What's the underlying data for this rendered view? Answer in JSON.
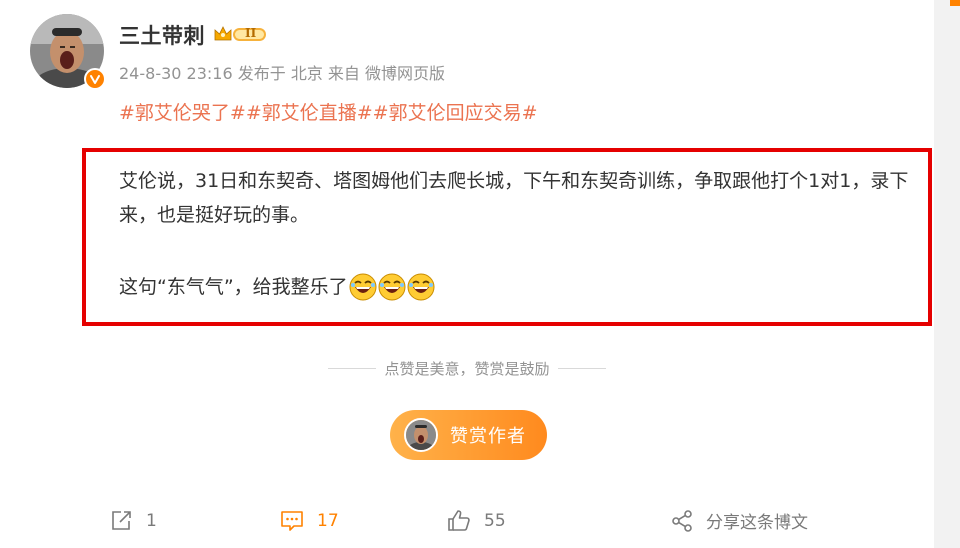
{
  "post": {
    "user_name": "三土带刺",
    "level_badge": "II",
    "meta": "24-8-30 23:16 发布于 北京 来自 微博网页版",
    "hashtags": "#郭艾伦哭了##郭艾伦直播##郭艾伦回应交易#",
    "paragraph_1": "艾伦说，31日和东契奇、塔图姆他们去爬长城，下午和东契奇训练，争取跟他打个1对1，录下来，也是挺好玩的事。",
    "paragraph_2": "这句“东气气”，给我整乐了",
    "emoji": [
      "laughing-emoji",
      "laughing-emoji",
      "laughing-emoji"
    ]
  },
  "reward": {
    "encourage_text": "点赞是美意，赞赏是鼓励",
    "button_label": "赞赏作者"
  },
  "actions": {
    "repost_count": "1",
    "comment_count": "17",
    "like_count": "55",
    "share_label": "分享这条博文"
  },
  "colors": {
    "accent": "#ff8200",
    "hashtag": "#eb7350",
    "highlight_border": "#e50000",
    "meta_text": "#939393"
  }
}
